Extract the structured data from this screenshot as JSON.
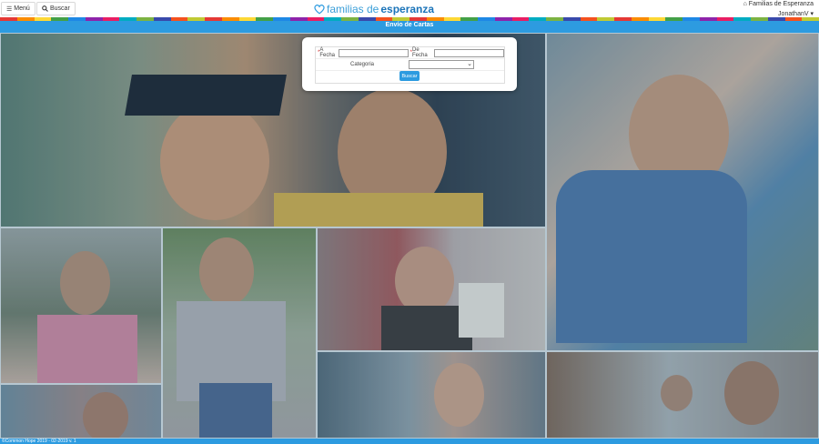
{
  "header": {
    "menu_label": "Menú",
    "search_label": "Buscar",
    "logo_light": "familias de ",
    "logo_bold": "esperanza",
    "org_name": "Familias de Esperanza",
    "user_name": "JonathanV"
  },
  "page": {
    "title": "Envío de Cartas"
  },
  "form": {
    "from_label": "A Fecha",
    "to_label": "De Fecha",
    "from_value": "",
    "to_value": "",
    "category_label": "Categoria",
    "category_value": "",
    "search_button": "Buscar"
  },
  "footer": {
    "text": "©Common Hope 2019 - 02-2019 v. 1"
  },
  "colors": {
    "accent": "#2d9be0",
    "logo_blue": "#1a73b8",
    "stripe": [
      "#e53935",
      "#fb8c00",
      "#fdd835",
      "#43a047",
      "#1e88e5",
      "#8e24aa",
      "#e91e63",
      "#00acc1",
      "#7cb342",
      "#3949ab",
      "#f4511e",
      "#c0ca33"
    ]
  },
  "icons": [
    "hamburger-icon",
    "search-icon",
    "heart-logo-icon",
    "house-icon",
    "chevron-down-icon"
  ]
}
